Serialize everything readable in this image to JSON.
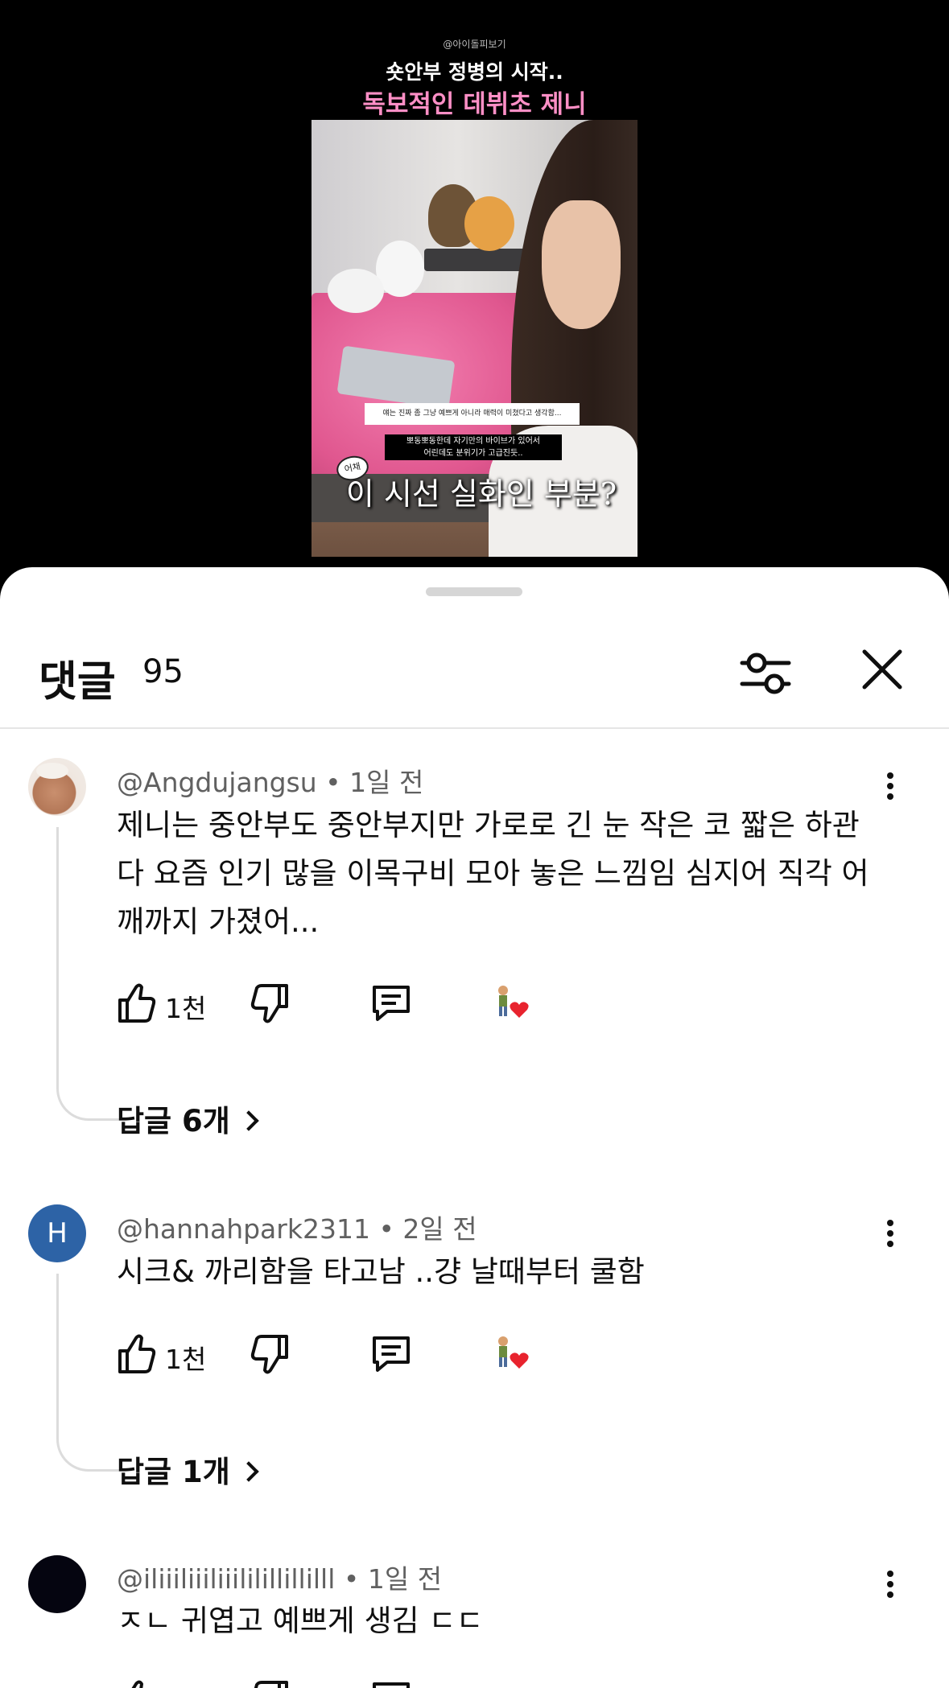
{
  "video": {
    "watermark": "@아이돌피보기",
    "title_line1": "숏안부 정병의 시작..",
    "title_line2": "독보적인 데뷔초 제니",
    "caption_top": "얘는 진짜 좀 그냥 예쁘게 아니라 매력이 미쳤다고 생각함...",
    "caption_mid_1": "뽀동뽀동한데 자기만의 바이브가 있어서",
    "caption_mid_2": "어린데도 분위기가 고급진듯..",
    "caption_tag": "어채",
    "caption_main": "이 시선 실화인 부분?"
  },
  "header": {
    "title": "댓글",
    "count": "95"
  },
  "colors": {
    "pink_title": "#ff8fc6",
    "avatar_blue": "#2d63a6",
    "heart_red": "#e8232e"
  },
  "comments": [
    {
      "author": "@Angdujangsu",
      "time": "1일 전",
      "text": "제니는 중안부도 중안부지만 가로로 긴 눈 작은 코 짧은 하관 다 요즘 인기 많을 이목구비 모아 놓은 느낌임 심지어 직각 어깨까지 가졌어...",
      "likes": "1천",
      "replies": "답글 6개",
      "avatar": "photo"
    },
    {
      "author": "@hannahpark2311",
      "time": "2일 전",
      "text": "시크& 까리함을 타고남 ..걍 날때부터 쿨함",
      "likes": "1천",
      "replies": "답글 1개",
      "avatar": "H"
    },
    {
      "author": "@iliiiliiiliiililillillilll",
      "time": "1일 전",
      "text": "ㅈㄴ 귀엽고 예쁘게 생김 ㄷㄷ",
      "avatar": "dark"
    }
  ],
  "icons": {
    "filter": "sliders-icon",
    "close": "close-icon",
    "more": "more-vertical-icon",
    "like": "thumbs-up-icon",
    "dislike": "thumbs-down-icon",
    "reply": "comment-icon",
    "creator_heart": "creator-heart-icon"
  }
}
